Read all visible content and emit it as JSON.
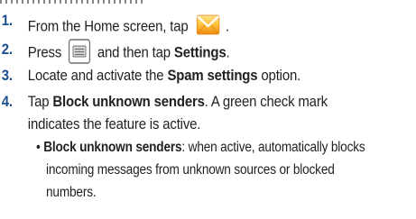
{
  "steps": [
    {
      "number": "1.",
      "text_before": "From the Home screen, tap",
      "icon": "messaging-envelope-icon",
      "text_after": "."
    },
    {
      "number": "2.",
      "text_before": "Press",
      "icon": "menu-key-icon",
      "text_middle": "and then tap",
      "bold": "Settings",
      "text_after": "."
    },
    {
      "number": "3.",
      "text_before": "Locate and activate the",
      "bold": "Spam settings",
      "text_after": "option."
    },
    {
      "number": "4.",
      "text_before": "Tap",
      "bold": "Block unknown senders",
      "text_after": ". A green check mark",
      "continuation": "indicates the feature is active."
    }
  ],
  "bullet": {
    "symbol": "•",
    "bold": "Block unknown senders",
    "text_line1": ": when active, automatically blocks",
    "text_line2": "incoming messages from unknown sources or blocked",
    "text_line3": "numbers."
  },
  "colors": {
    "step_number": "#1a4f8f",
    "text": "#231f20",
    "envelope_orange": "#f39a1c",
    "envelope_light": "#ffd36a"
  }
}
